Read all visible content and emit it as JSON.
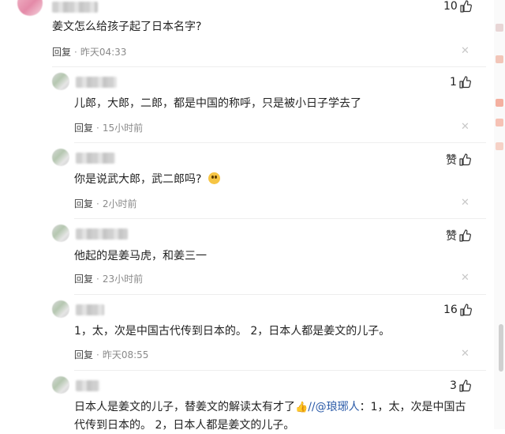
{
  "comments": [
    {
      "text": "姜文怎么给孩子起了日本名字?",
      "reply": "回复",
      "time": "昨天04:33",
      "likes": "10"
    },
    {
      "text": "儿郎，大郎，二郎，都是中国的称呼，只是被小日子学去了",
      "reply": "回复",
      "time": "15小时前",
      "likes": "1"
    },
    {
      "text": "你是说武大郎，武二郎吗?",
      "reply": "回复",
      "time": "2小时前",
      "likes": "赞"
    },
    {
      "text": "他起的是姜马虎，和姜三一",
      "reply": "回复",
      "time": "23小时前",
      "likes": "赞"
    },
    {
      "text": "1，太，次是中国古代传到日本的。 2，日本人都是姜文的儿子。",
      "reply": "回复",
      "time": "昨天08:55",
      "likes": "16"
    },
    {
      "text_before": "日本人是姜文的儿子，替姜文的解读太有才了",
      "text_mention": "//@琅琊人",
      "text_after": "：1，太，次是中国古代传到日本的。 2，日本人都是姜文的儿子。",
      "likes": "3"
    }
  ],
  "icons": {
    "like": "thumb-up-icon",
    "close": "close-icon"
  },
  "colors": {
    "mention": "#2a5aa8",
    "meta": "#8a8a8a"
  }
}
